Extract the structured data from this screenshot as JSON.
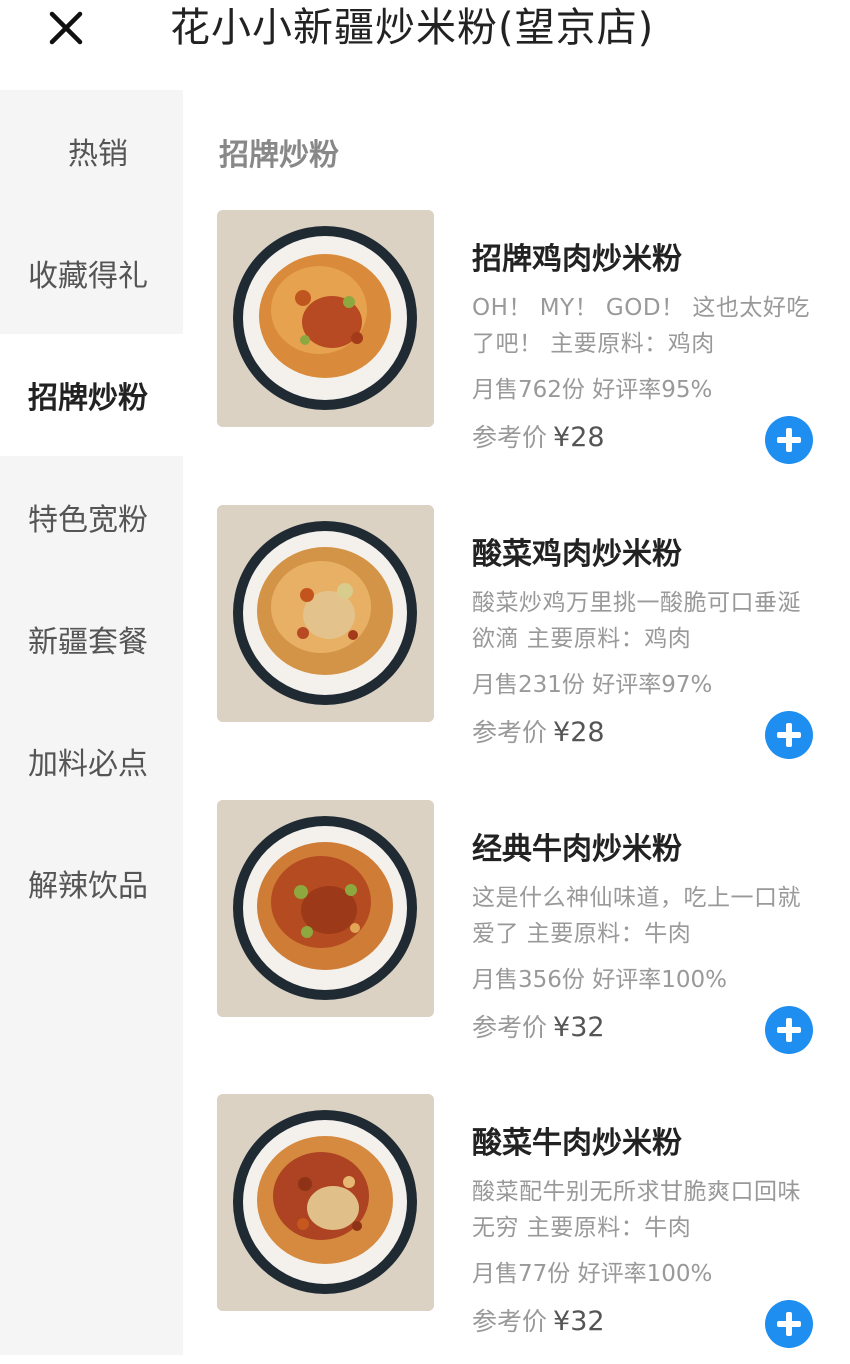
{
  "header": {
    "title": "花小小新疆炒米粉(望京店)",
    "close_icon": "close-icon"
  },
  "sidebar": {
    "items": [
      {
        "label": "热销"
      },
      {
        "label": "收藏得礼"
      },
      {
        "label": "招牌炒粉",
        "active": true
      },
      {
        "label": "特色宽粉"
      },
      {
        "label": "新疆套餐"
      },
      {
        "label": "加料必点"
      },
      {
        "label": "解辣饮品"
      }
    ]
  },
  "main": {
    "section_title": "招牌炒粉",
    "items": [
      {
        "name": "招牌鸡肉炒米粉",
        "desc": "OH！ MY！ GOD！ 这也太好吃了吧！ 主要原料：鸡肉",
        "sales": "月售762份 好评率95%",
        "price_label": "参考价",
        "price": "¥28"
      },
      {
        "name": "酸菜鸡肉炒米粉",
        "desc": "酸菜炒鸡万里挑一酸脆可口垂涎欲滴 主要原料：鸡肉",
        "sales": "月售231份 好评率97%",
        "price_label": "参考价",
        "price": "¥28"
      },
      {
        "name": "经典牛肉炒米粉",
        "desc": "这是什么神仙味道，吃上一口就爱了 主要原料：牛肉",
        "sales": "月售356份 好评率100%",
        "price_label": "参考价",
        "price": "¥32"
      },
      {
        "name": "酸菜牛肉炒米粉",
        "desc": "酸菜配牛别无所求甘脆爽口回味无穷 主要原料：牛肉",
        "sales": "月售77份 好评率100%",
        "price_label": "参考价",
        "price": "¥32"
      }
    ]
  },
  "colors": {
    "accent": "#1e8ef0",
    "sidebar_bg": "#f5f5f5",
    "muted_text": "#999999"
  }
}
